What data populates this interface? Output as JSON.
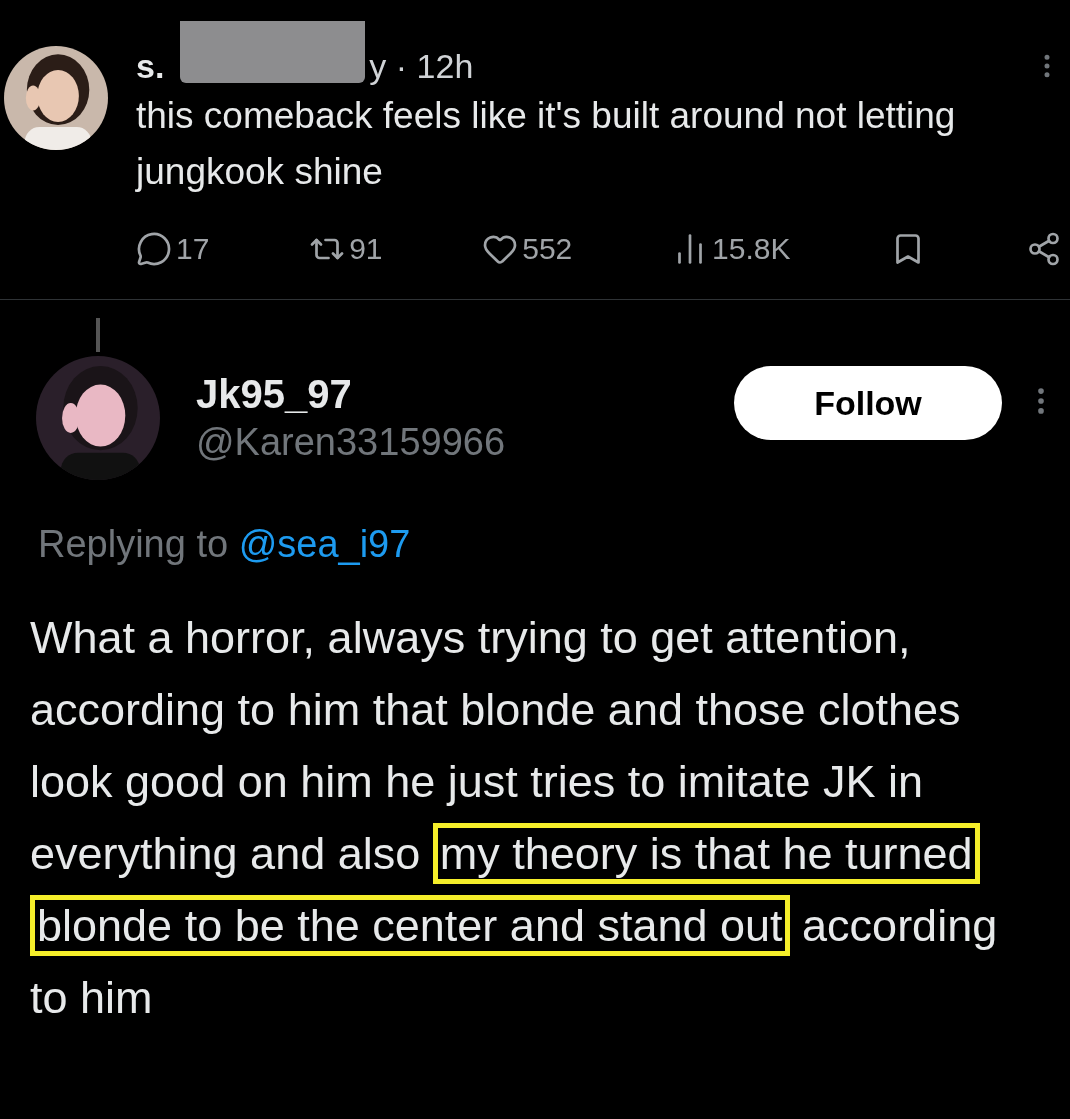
{
  "parent_tweet": {
    "name": "s.",
    "handle_tail": "y",
    "time": "· 12h",
    "text": "this comeback feels like it's built around not letting jungkook shine",
    "redacted": true,
    "actions": [
      {
        "kind": "reply",
        "count": "17"
      },
      {
        "kind": "repost",
        "count": "91"
      },
      {
        "kind": "like",
        "count": "552"
      },
      {
        "kind": "views",
        "count": "15.8K"
      },
      {
        "kind": "bookmark"
      },
      {
        "kind": "share"
      }
    ]
  },
  "reply_tweet": {
    "name": "Jk95_97",
    "handle": "@Karen33159966",
    "follow_button": "Follow",
    "replying_label": "Replying to",
    "replying_to": "@sea_i97",
    "segments": [
      {
        "text": "What a horror, always trying to get attention, according to him that blonde and those clothes look good on him he just tries to imitate JK in everything and also ",
        "highlighted": false
      },
      {
        "text": "my theory is that he turned blonde to be the center and stand out",
        "highlighted": true
      },
      {
        "text": " according to him",
        "highlighted": false
      }
    ]
  }
}
